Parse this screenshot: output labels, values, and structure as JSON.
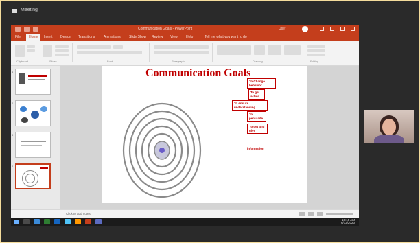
{
  "meeting": {
    "window_title": "Meeting"
  },
  "powerpoint": {
    "title_doc": "Communication Goals - PowerPoint",
    "user_name": "User",
    "tabs": [
      "File",
      "Home",
      "Insert",
      "Design",
      "Transitions",
      "Animations",
      "Slide Show",
      "Review",
      "View",
      "Help",
      "Tell me what you want to do"
    ],
    "ribbon_groups": [
      "Clipboard",
      "Slides",
      "Font",
      "Paragraph",
      "Drawing",
      "Editing"
    ],
    "slide_numbers": [
      "1",
      "2",
      "3",
      "4"
    ],
    "status_text": "Click to add notes",
    "slide": {
      "title": "Communication Goals",
      "boxes": [
        "To Change behavior",
        "To get action",
        "To ensure understanding",
        "To persuade",
        "To get and give",
        "information"
      ]
    }
  },
  "taskbar": {
    "time": "10:15 AM",
    "date": "6/12/2020"
  }
}
